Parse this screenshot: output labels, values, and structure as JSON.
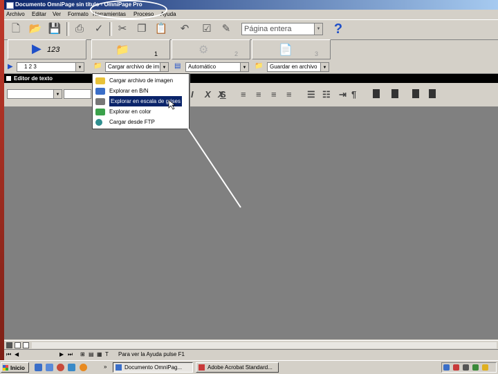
{
  "window": {
    "title": "Documento OmniPage sin título - OmniPage Pro"
  },
  "menu": [
    "Archivo",
    "Editar",
    "Ver",
    "Formato",
    "Herramientas",
    "Proceso",
    "Ayuda"
  ],
  "toolbar": {
    "view_combo": "Página entera"
  },
  "process_buttons": {
    "ocr_label": "123",
    "step1": "1",
    "step2": "2",
    "step3": "3"
  },
  "row3": {
    "pages": "1  2  3",
    "load_combo": "Cargar archivo de im",
    "recognition_combo": "Automático",
    "save_combo": "Guardar en archivo"
  },
  "editor": {
    "title": "Editor de texto"
  },
  "format_buttons": [
    "I",
    "X",
    "X",
    "S",
    "¶"
  ],
  "dropdown": {
    "items": [
      {
        "label": "Cargar archivo de imagen",
        "icon": "folder-image-icon",
        "color": "#e8c23a"
      },
      {
        "label": "Explorar en B/N",
        "icon": "scanner-icon",
        "color": "#3a6ec8"
      },
      {
        "label": "Explorar en escala de grises",
        "icon": "scanner-gray-icon",
        "color": "#777777"
      },
      {
        "label": "Explorar en color",
        "icon": "scanner-color-icon",
        "color": "#3aa14a"
      },
      {
        "label": "Cargar desde FTP",
        "icon": "globe-icon",
        "color": "#2f8f8f"
      }
    ],
    "selected_index": 2
  },
  "status": {
    "help_text": "Para ver la Ayuda pulse F1"
  },
  "taskbar": {
    "start_label": "Inicio",
    "tasks": [
      "Documento OmniPag...",
      "Adobe Acrobat Standard..."
    ]
  },
  "colors": {
    "titlebar": "#0a246a",
    "selection": "#0a246a",
    "desktop": "#c0392b",
    "document_area": "#808080"
  }
}
